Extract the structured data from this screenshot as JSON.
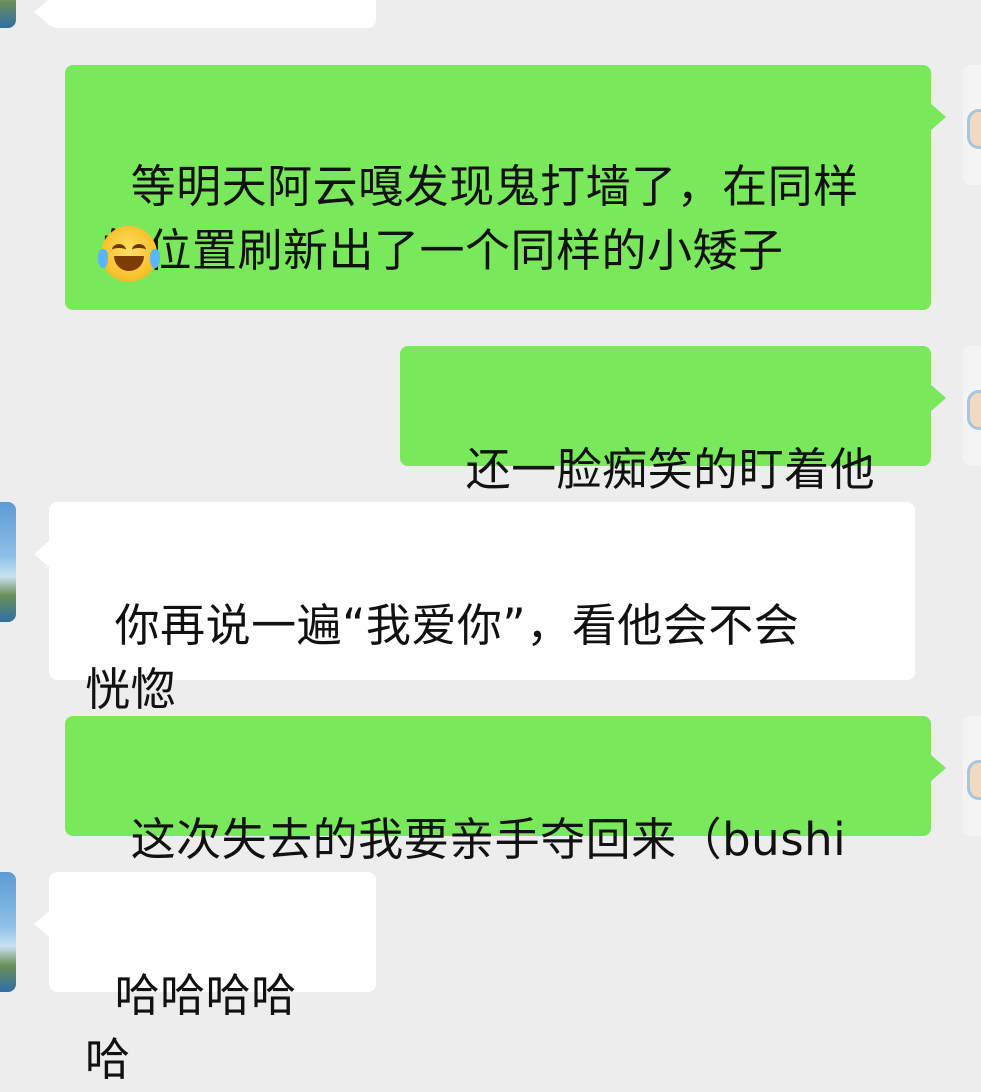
{
  "messages": [
    {
      "side": "incoming",
      "text": ""
    },
    {
      "side": "outgoing",
      "text": "等明天阿云嘎发现鬼打墙了，在同样\n的位置刷新出了一个同样的小矮子",
      "emoji": "crying-laughing-emoji"
    },
    {
      "side": "outgoing",
      "text": "还一脸痴笑的盯着他"
    },
    {
      "side": "incoming",
      "text": "你再说一遍“我爱你”，看他会不会\n恍惚"
    },
    {
      "side": "outgoing",
      "text": "这次失去的我要亲手夺回来（bushi"
    },
    {
      "side": "incoming",
      "text": "哈哈哈哈哈"
    }
  ],
  "colors": {
    "background": "#ededed",
    "outgoing_bubble": "#79e85b",
    "incoming_bubble": "#ffffff",
    "text": "#111111"
  }
}
